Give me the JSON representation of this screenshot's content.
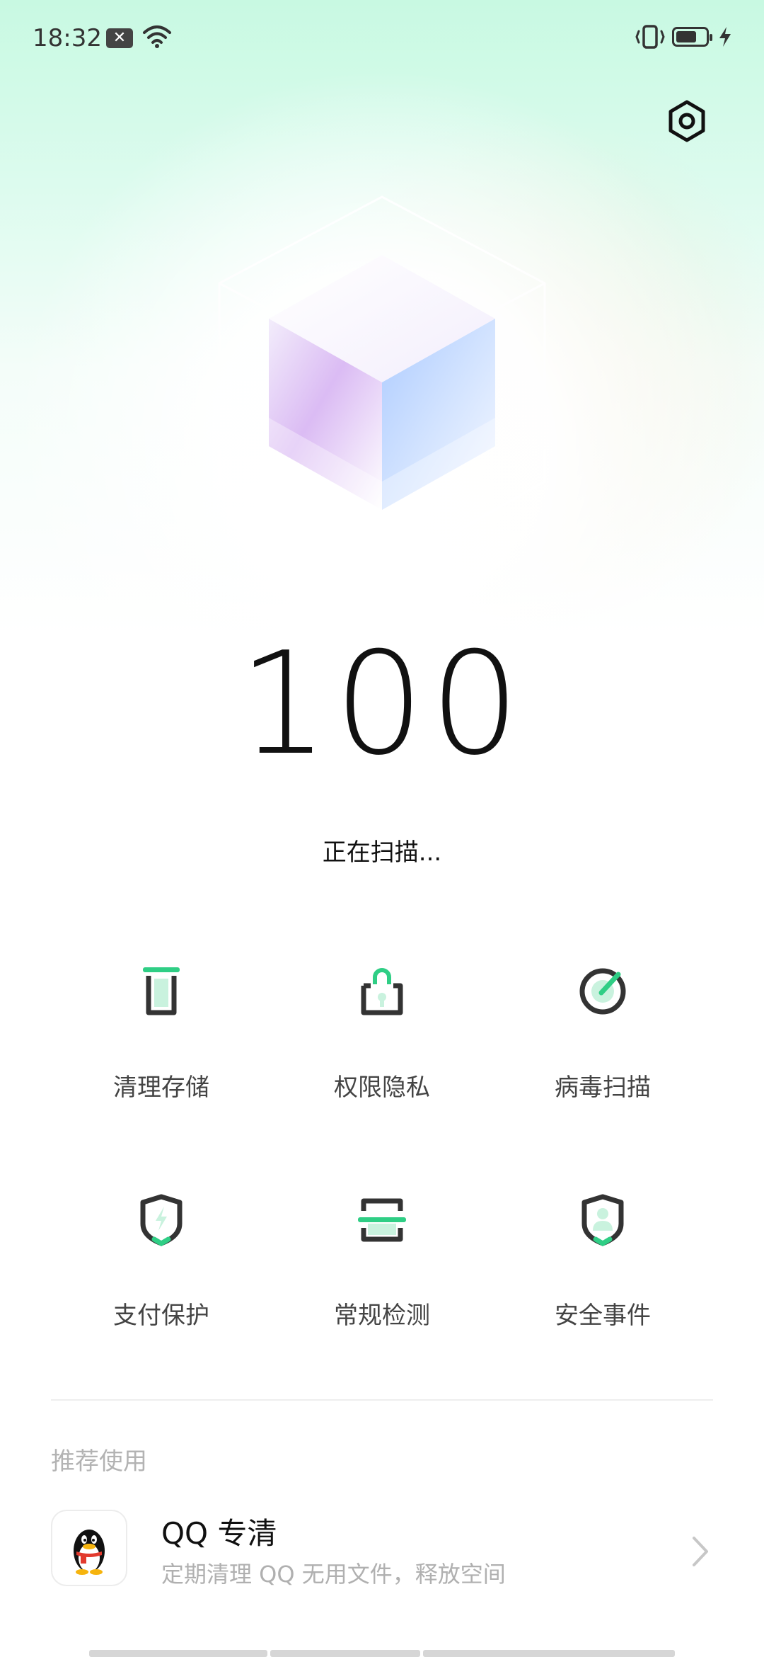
{
  "status_bar": {
    "time": "18:32",
    "notification_icon": "close-notification-icon",
    "battery_level": 0.7
  },
  "header": {
    "settings_icon": "settings-hexagon-icon"
  },
  "score": {
    "value": "100",
    "status": "正在扫描..."
  },
  "features": [
    {
      "label": "清理存储",
      "icon": "trash-clean-icon"
    },
    {
      "label": "权限隐私",
      "icon": "lock-privacy-icon"
    },
    {
      "label": "病毒扫描",
      "icon": "virus-scan-icon"
    },
    {
      "label": "支付保护",
      "icon": "payment-shield-icon"
    },
    {
      "label": "常规检测",
      "icon": "scan-frame-icon"
    },
    {
      "label": "安全事件",
      "icon": "user-shield-icon"
    }
  ],
  "recommend": {
    "section_title": "推荐使用",
    "items": [
      {
        "title": "QQ 专清",
        "desc": "定期清理 QQ 无用文件，释放空间",
        "icon": "qq-penguin-icon"
      }
    ]
  },
  "colors": {
    "accent": "#2fce85",
    "icon_dark": "#333333",
    "bg_top": "#c8f9e2"
  }
}
